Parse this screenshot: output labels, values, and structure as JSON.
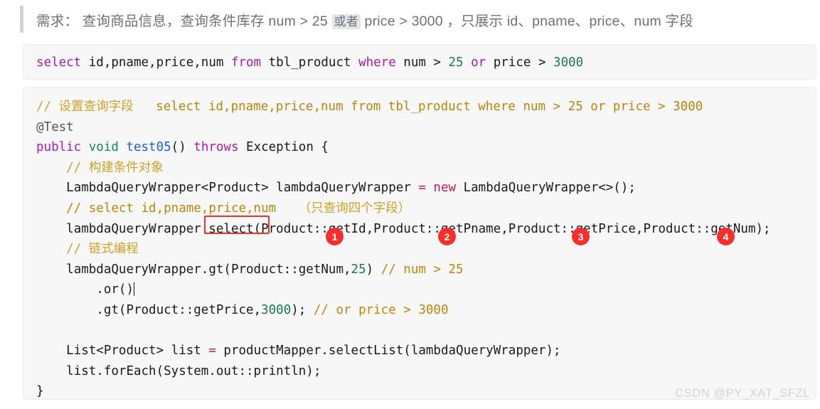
{
  "requirement": {
    "prefix": "需求： 查询商品信息，查询条件库存 num > 25 ",
    "badge": "或者",
    "suffix": " price > 3000 ，只展示 id、pname、price、num 字段"
  },
  "sql_block": {
    "keyword_select": "select",
    "columns": " id,pname,price,num ",
    "keyword_from": "from",
    "table": " tbl_product ",
    "keyword_where": "where",
    "cond_left": " num > ",
    "num_25": "25",
    "keyword_or": " or",
    "cond_right": " price > ",
    "num_3000": "3000"
  },
  "java_block": {
    "line1_comment": "// 设置查询字段",
    "line1_sql": "select id,pname,price,num from tbl_product where num > 25 or price > 3000",
    "line2_annotation": "@Test",
    "line3_public": "public",
    "line3_void": " void",
    "line3_method": " test05",
    "line3_parens": "() ",
    "line3_throws": "throws",
    "line3_exception": " Exception {",
    "line4_comment": "// 构建条件对象",
    "line5_type": "LambdaQueryWrapper<Product> lambdaQueryWrapper ",
    "line5_eq": "=",
    "line5_new": " new",
    "line5_ctor": " LambdaQueryWrapper<>();",
    "line6_comment": "// select id,pname,price,num",
    "line6_comment_zh": "（只查询四个字段）",
    "line7_receiver": "lambdaQueryWrapper",
    "line7_select": ".select(",
    "line7_args": "Product::getId,Product::getPname,Product::getPrice,Product::getNum);",
    "line8_comment": "// 链式编程",
    "line9_a": "lambdaQueryWrapper.gt(Product::getNum,",
    "line9_num": "25",
    "line9_b": ") ",
    "line9_comment": "// num > 25",
    "line10_or": ".or()",
    "line11_a": ".gt(Product::getPrice,",
    "line11_num": "3000",
    "line11_b": "); ",
    "line11_comment": "// or price > 3000",
    "line12_list": "List<Product> list ",
    "line12_eq": "=",
    "line12_call": " productMapper.selectList(lambdaQueryWrapper);",
    "line13": "list.forEach(System.out::println);",
    "line14": "}"
  },
  "annotations": {
    "highlight_target": ".select(",
    "markers": [
      "1",
      "2",
      "3",
      "4"
    ],
    "marker_color": "#fa2d2d",
    "box_color": "#f0322b"
  },
  "watermark": {
    "text": "CSDN @PY_XAT_SFZL"
  }
}
